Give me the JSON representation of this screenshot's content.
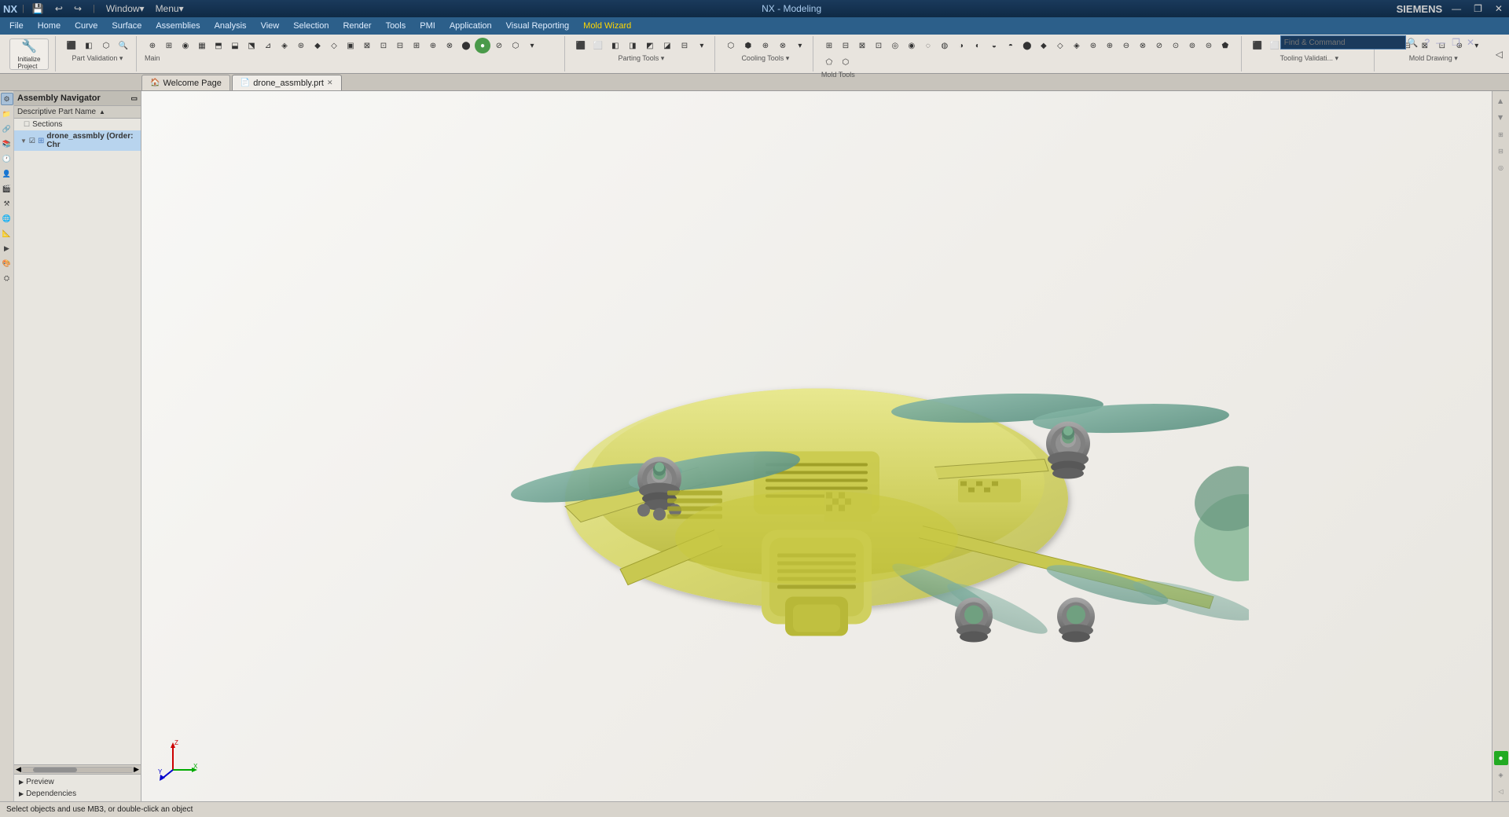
{
  "titlebar": {
    "app_name": "NX",
    "title": "NX - Modeling",
    "company": "SIEMENS",
    "minimize": "—",
    "restore": "❐",
    "close": "✕",
    "pin_icon": "📌",
    "quick_access": [
      "↩",
      "↪",
      "💾"
    ]
  },
  "menubar": {
    "items": [
      "File",
      "Home",
      "Curve",
      "Surface",
      "Assemblies",
      "Analysis",
      "View",
      "Selection",
      "Render",
      "Tools",
      "PMI",
      "Application",
      "Visual Reporting",
      "Mold Wizard"
    ],
    "active_item": "Mold Wizard"
  },
  "find_command": {
    "placeholder": "Find & Command",
    "label": "Find & Command"
  },
  "toolbar_groups": [
    {
      "label": "Part Validation",
      "has_dropdown": true
    },
    {
      "label": "Main",
      "has_dropdown": false
    },
    {
      "label": "Parting Tools",
      "has_dropdown": true
    },
    {
      "label": "Cooling Tools",
      "has_dropdown": true
    },
    {
      "label": "Mold Tools",
      "has_dropdown": false
    },
    {
      "label": "Tooling Validati...",
      "has_dropdown": true
    },
    {
      "label": "Mold Drawing",
      "has_dropdown": true
    }
  ],
  "tabs": [
    {
      "label": "Welcome Page",
      "active": false,
      "closeable": false,
      "icon": "🏠"
    },
    {
      "label": "drone_assmbly.prt",
      "active": true,
      "closeable": true,
      "icon": "📄",
      "modified": true
    }
  ],
  "left_sidebar": {
    "navigator_header": "Assembly Navigator",
    "col_header": "Descriptive Part Name",
    "sections_label": "Sections",
    "tree_items": [
      {
        "label": "drone_assmbly (Order: Chr",
        "expanded": true,
        "level": 0,
        "checked": true,
        "icon": "⚙"
      }
    ],
    "bottom_sections": [
      "Preview",
      "Dependencies"
    ]
  },
  "left_icons": [
    {
      "name": "assembly-navigator-icon",
      "symbol": "⚙",
      "active": true
    },
    {
      "name": "part-navigator-icon",
      "symbol": "📁",
      "active": false
    },
    {
      "name": "reuse-library-icon",
      "symbol": "📚",
      "active": false
    },
    {
      "name": "history-icon",
      "symbol": "🕐",
      "active": false
    },
    {
      "name": "roles-icon",
      "symbol": "👤",
      "active": false
    },
    {
      "name": "system-scenes-icon",
      "symbol": "🎬",
      "active": false
    },
    {
      "name": "process-studio-icon",
      "symbol": "🔧",
      "active": false
    },
    {
      "name": "web-browser-icon",
      "symbol": "🌐",
      "active": false
    },
    {
      "name": "hd-3d-icon",
      "symbol": "📐",
      "active": false
    },
    {
      "name": "motion-icon",
      "symbol": "▶",
      "active": false
    },
    {
      "name": "manufacture-icon",
      "symbol": "⚒",
      "active": false
    },
    {
      "name": "palette-icon",
      "symbol": "🎨",
      "active": false
    }
  ],
  "right_sidebar_icons": [
    {
      "name": "right-panel-1",
      "symbol": "◀"
    },
    {
      "name": "right-panel-2",
      "symbol": "▶"
    },
    {
      "name": "right-panel-3",
      "symbol": "⬆"
    },
    {
      "name": "right-panel-4",
      "symbol": "⬇"
    },
    {
      "name": "right-panel-green",
      "symbol": "●",
      "green": true
    },
    {
      "name": "right-panel-5",
      "symbol": "◈"
    },
    {
      "name": "right-panel-6",
      "symbol": "⊞"
    }
  ],
  "statusbar": {
    "message": "Select objects and use MB3, or double-click an object"
  },
  "viewport": {
    "background_color": "#f5f4f0"
  }
}
